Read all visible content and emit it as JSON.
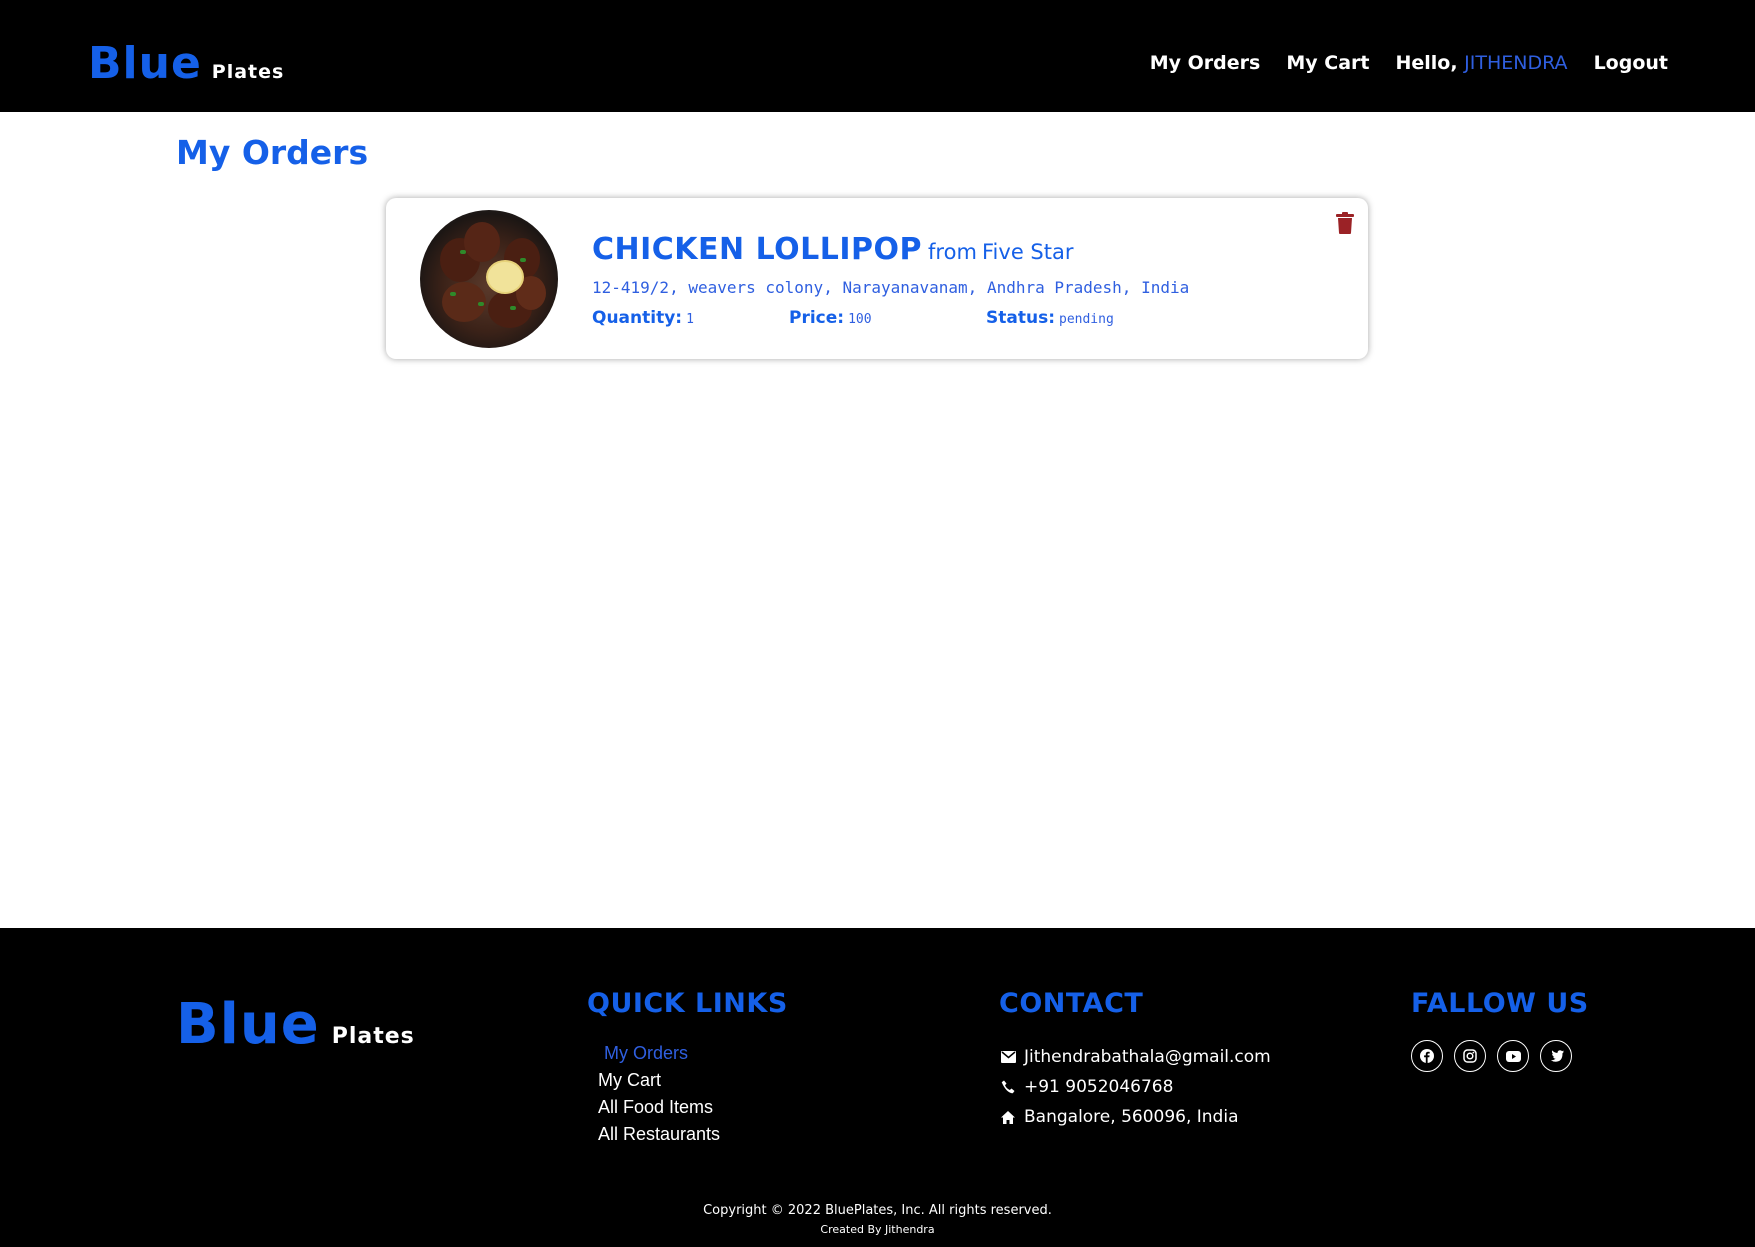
{
  "navbar": {
    "brand_main": "Blue",
    "brand_sub": "Plates",
    "links": {
      "orders": "My Orders",
      "cart": "My Cart",
      "hello": "Hello, ",
      "user": "JITHENDRA",
      "logout": "Logout"
    }
  },
  "page": {
    "title": "My Orders"
  },
  "orders": [
    {
      "food_name": "CHICKEN LOLLIPOP",
      "from_label": "from",
      "restaurant": "Five Star",
      "address": "12-419/2, weavers colony, Narayanavanam, Andhra Pradesh, India",
      "quantity_label": "Quantity:",
      "quantity": "1",
      "price_label": "Price:",
      "price": "100",
      "status_label": "Status:",
      "status": "pending",
      "delete_icon": "trash-icon"
    }
  ],
  "footer": {
    "brand_main": "Blue",
    "brand_sub": "Plates",
    "quick_links_heading": "QUICK LINKS",
    "quick_links": [
      "My Orders",
      "My Cart",
      "All Food Items",
      "All Restaurants"
    ],
    "contact_heading": "CONTACT",
    "contact": {
      "email": "Jithendrabathala@gmail.com",
      "phone": "+91 9052046768",
      "address": "Bangalore, 560096, India"
    },
    "follow_heading": "FALLOW US",
    "social_icons": [
      "facebook-icon",
      "instagram-icon",
      "youtube-icon",
      "twitter-icon"
    ],
    "copyright": "Copyright © 2022 BluePlates, Inc. All rights reserved.",
    "created_by": "Created By Jithendra"
  },
  "colors": {
    "accent": "#1560e8",
    "nav_bg": "#000000",
    "delete": "#9b2226"
  }
}
